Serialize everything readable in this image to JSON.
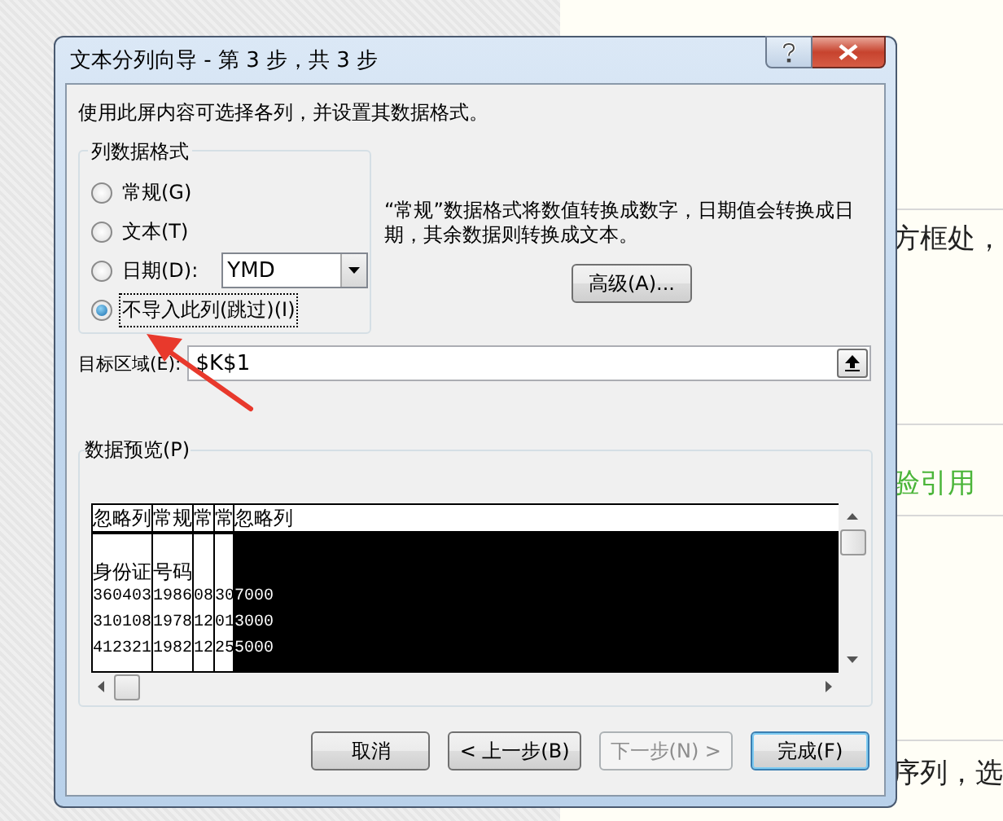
{
  "window": {
    "title": "文本分列向导 - 第 3 步，共 3 步"
  },
  "instruction": "使用此屏内容可选择各列，并设置其数据格式。",
  "column_format": {
    "title": "列数据格式",
    "options": [
      {
        "label": "常规(G)",
        "selected": false,
        "kind": "plain"
      },
      {
        "label": "文本(T)",
        "selected": false,
        "kind": "plain"
      },
      {
        "label": "日期(D):",
        "selected": false,
        "kind": "date",
        "value": "YMD"
      },
      {
        "label": "不导入此列(跳过)(I)",
        "selected": true,
        "kind": "plain"
      }
    ]
  },
  "description_lines": [
    "“常规”数据格式将数值转换成数字，日期值会转换成日",
    "期，其余数据则转换成文本。"
  ],
  "advanced_button": "高级(A)...",
  "destination": {
    "label": "目标区域(E):",
    "value": "$K$1"
  },
  "preview": {
    "title": "数据预览(P)",
    "columns": [
      {
        "header": "忽略列",
        "selected": false
      },
      {
        "header": "常规",
        "selected": false
      },
      {
        "header": "常",
        "selected": false
      },
      {
        "header": "常",
        "selected": false
      },
      {
        "header": "忽略列",
        "selected": true
      }
    ],
    "rows": [
      {
        "cells": [
          "身份证",
          "号码"
        ]
      },
      {
        "cells": [
          "360403",
          "1986",
          "08",
          "30",
          "7000"
        ]
      },
      {
        "cells": [
          "310108",
          "1978",
          "12",
          "01",
          "3000"
        ]
      },
      {
        "cells": [
          "412321",
          "1982",
          "12",
          "25",
          "5000"
        ]
      }
    ]
  },
  "buttons": [
    {
      "label": "取消",
      "disabled": false,
      "default": false
    },
    {
      "label": "< 上一步(B)",
      "disabled": false,
      "default": false
    },
    {
      "label": "下一步(N) >",
      "disabled": true,
      "default": false
    },
    {
      "label": "完成(F)",
      "disabled": false,
      "default": true
    }
  ],
  "background_page": {
    "texts": [
      {
        "text": "方框处，",
        "kind": "plain"
      },
      {
        "text": "验引用",
        "kind": "heading"
      },
      {
        "text": "序列，选",
        "kind": "plain"
      }
    ]
  }
}
